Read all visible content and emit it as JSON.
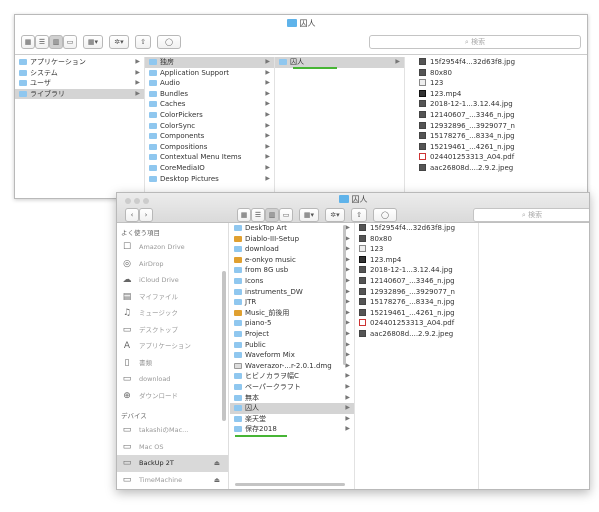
{
  "back": {
    "title": "囚人",
    "search_placeholder": "検索",
    "col1": [
      {
        "label": "アプリケーション"
      },
      {
        "label": "システム"
      },
      {
        "label": "ユーザ"
      },
      {
        "label": "ライブラリ",
        "selected": true
      }
    ],
    "col2": [
      {
        "label": "独房",
        "selected": true
      },
      {
        "label": "Application Support"
      },
      {
        "label": "Audio"
      },
      {
        "label": "Bundles"
      },
      {
        "label": "Caches"
      },
      {
        "label": "ColorPickers"
      },
      {
        "label": "ColorSync"
      },
      {
        "label": "Components"
      },
      {
        "label": "Compositions"
      },
      {
        "label": "Contextual Menu Items"
      },
      {
        "label": "CoreMediaIO"
      },
      {
        "label": "Desktop Pictures"
      }
    ],
    "col3": [
      {
        "label": "囚人",
        "selected": true
      }
    ],
    "col4": [
      {
        "label": "15f2954f4...32d63f8.jpg",
        "icon": "img"
      },
      {
        "label": "80x80",
        "icon": "img"
      },
      {
        "label": "123",
        "icon": "doc"
      },
      {
        "label": "123.mp4",
        "icon": "mov"
      },
      {
        "label": "2018-12-1...3.12.44.jpg",
        "icon": "img"
      },
      {
        "label": "12140607_...3346_n.jpg",
        "icon": "img"
      },
      {
        "label": "12932896_...3929077_n",
        "icon": "img"
      },
      {
        "label": "15178276_...8334_n.jpg",
        "icon": "img"
      },
      {
        "label": "15219461_...4261_n.jpg",
        "icon": "img"
      },
      {
        "label": "024401253313_A04.pdf",
        "icon": "pdf"
      },
      {
        "label": "aac26808d....2.9.2.jpeg",
        "icon": "img"
      }
    ]
  },
  "front": {
    "title": "囚人",
    "search_placeholder": "検索",
    "sidebar_header": "よく使う項目",
    "favorites": [
      {
        "label": "Amazon Drive",
        "icon": "☐"
      },
      {
        "label": "AirDrop",
        "icon": "◎"
      },
      {
        "label": "iCloud Drive",
        "icon": "☁"
      },
      {
        "label": "マイファイル",
        "icon": "▤"
      },
      {
        "label": "ミュージック",
        "icon": "♫"
      },
      {
        "label": "デスクトップ",
        "icon": "▭"
      },
      {
        "label": "アプリケーション",
        "icon": "A"
      },
      {
        "label": "書類",
        "icon": "▯"
      },
      {
        "label": "download",
        "icon": "▭"
      },
      {
        "label": "ダウンロード",
        "icon": "⊕"
      }
    ],
    "devices_header": "デバイス",
    "devices": [
      {
        "label": "takashiのMac...",
        "icon": "▭"
      },
      {
        "label": "Mac OS",
        "icon": "▭"
      },
      {
        "label": "BackUp 2T",
        "icon": "▭",
        "active": true,
        "eject": "⏏"
      },
      {
        "label": "TimeMachine",
        "icon": "▭",
        "eject": "⏏"
      }
    ],
    "col1": [
      {
        "label": "DeskTop Art",
        "icon": "f"
      },
      {
        "label": "Diablo-III-Setup",
        "icon": "app"
      },
      {
        "label": "download",
        "icon": "f"
      },
      {
        "label": "e-onkyo music",
        "icon": "app"
      },
      {
        "label": "from 8G usb",
        "icon": "f"
      },
      {
        "label": "Icons",
        "icon": "f"
      },
      {
        "label": "instruments_DW",
        "icon": "f"
      },
      {
        "label": "JTR",
        "icon": "f"
      },
      {
        "label": "Music_前後用",
        "icon": "app"
      },
      {
        "label": "piano-5",
        "icon": "f"
      },
      {
        "label": "Project",
        "icon": "f"
      },
      {
        "label": "Public",
        "icon": "f"
      },
      {
        "label": "Waveform Mix",
        "icon": "f"
      },
      {
        "label": "Waverazor-...r-2.0.1.dmg",
        "icon": "doc"
      },
      {
        "label": "ヒビノカラヲ幅C",
        "icon": "f"
      },
      {
        "label": "ペーパークラフト",
        "icon": "f"
      },
      {
        "label": "無本",
        "icon": "f"
      },
      {
        "label": "囚人",
        "icon": "f",
        "selected": true
      },
      {
        "label": "楽天堂",
        "icon": "f"
      },
      {
        "label": "保存2018",
        "icon": "f"
      }
    ],
    "col2": [
      {
        "label": "15f2954f4...32d63f8.jpg",
        "icon": "img"
      },
      {
        "label": "80x80",
        "icon": "img"
      },
      {
        "label": "123",
        "icon": "doc"
      },
      {
        "label": "123.mp4",
        "icon": "mov"
      },
      {
        "label": "2018-12-1...3.12.44.jpg",
        "icon": "img"
      },
      {
        "label": "12140607_...3346_n.jpg",
        "icon": "img"
      },
      {
        "label": "12932896_...3929077_n",
        "icon": "img"
      },
      {
        "label": "15178276_...8334_n.jpg",
        "icon": "img"
      },
      {
        "label": "15219461_...4261_n.jpg",
        "icon": "img"
      },
      {
        "label": "024401253313_A04.pdf",
        "icon": "pdf"
      },
      {
        "label": "aac26808d....2.9.2.jpeg",
        "icon": "img"
      }
    ]
  }
}
